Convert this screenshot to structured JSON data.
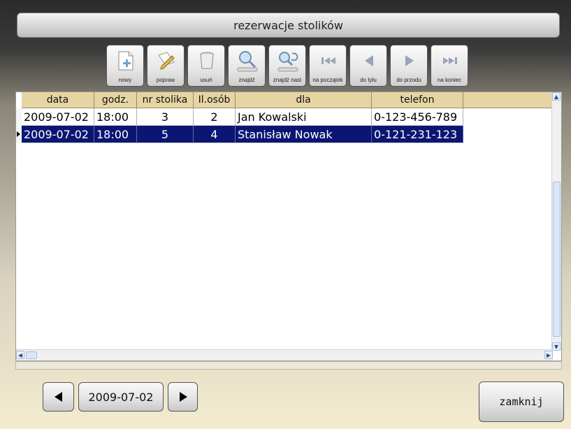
{
  "window": {
    "title": "rezerwacje stolików"
  },
  "toolbar": [
    {
      "label": "nowy",
      "icon": "new-document-icon"
    },
    {
      "label": "popraw",
      "icon": "edit-icon"
    },
    {
      "label": "usuń",
      "icon": "trash-icon"
    },
    {
      "label": "znajdź",
      "icon": "search-icon"
    },
    {
      "label": "znajdź nast",
      "icon": "search-next-icon"
    },
    {
      "label": "na początek",
      "icon": "first-record-icon"
    },
    {
      "label": "do tyłu",
      "icon": "previous-record-icon"
    },
    {
      "label": "do przodu",
      "icon": "next-record-icon"
    },
    {
      "label": "na koniec",
      "icon": "last-record-icon"
    }
  ],
  "grid": {
    "columns": [
      "data",
      "godz.",
      "nr stolika",
      "Il.osób",
      "dla",
      "telefon"
    ],
    "rows": [
      [
        "2009-07-02",
        "18:00",
        "3",
        "2",
        "Jan Kowalski",
        "0-123-456-789"
      ],
      [
        "2009-07-02",
        "18:00",
        "5",
        "4",
        "Stanisław Nowak",
        "0-121-231-123"
      ]
    ],
    "selected_row": 1
  },
  "footer": {
    "date": "2009-07-02",
    "close_label": "zamknij"
  },
  "colors": {
    "header_bg": "#e6d5a3",
    "selection": "#0b1674"
  }
}
